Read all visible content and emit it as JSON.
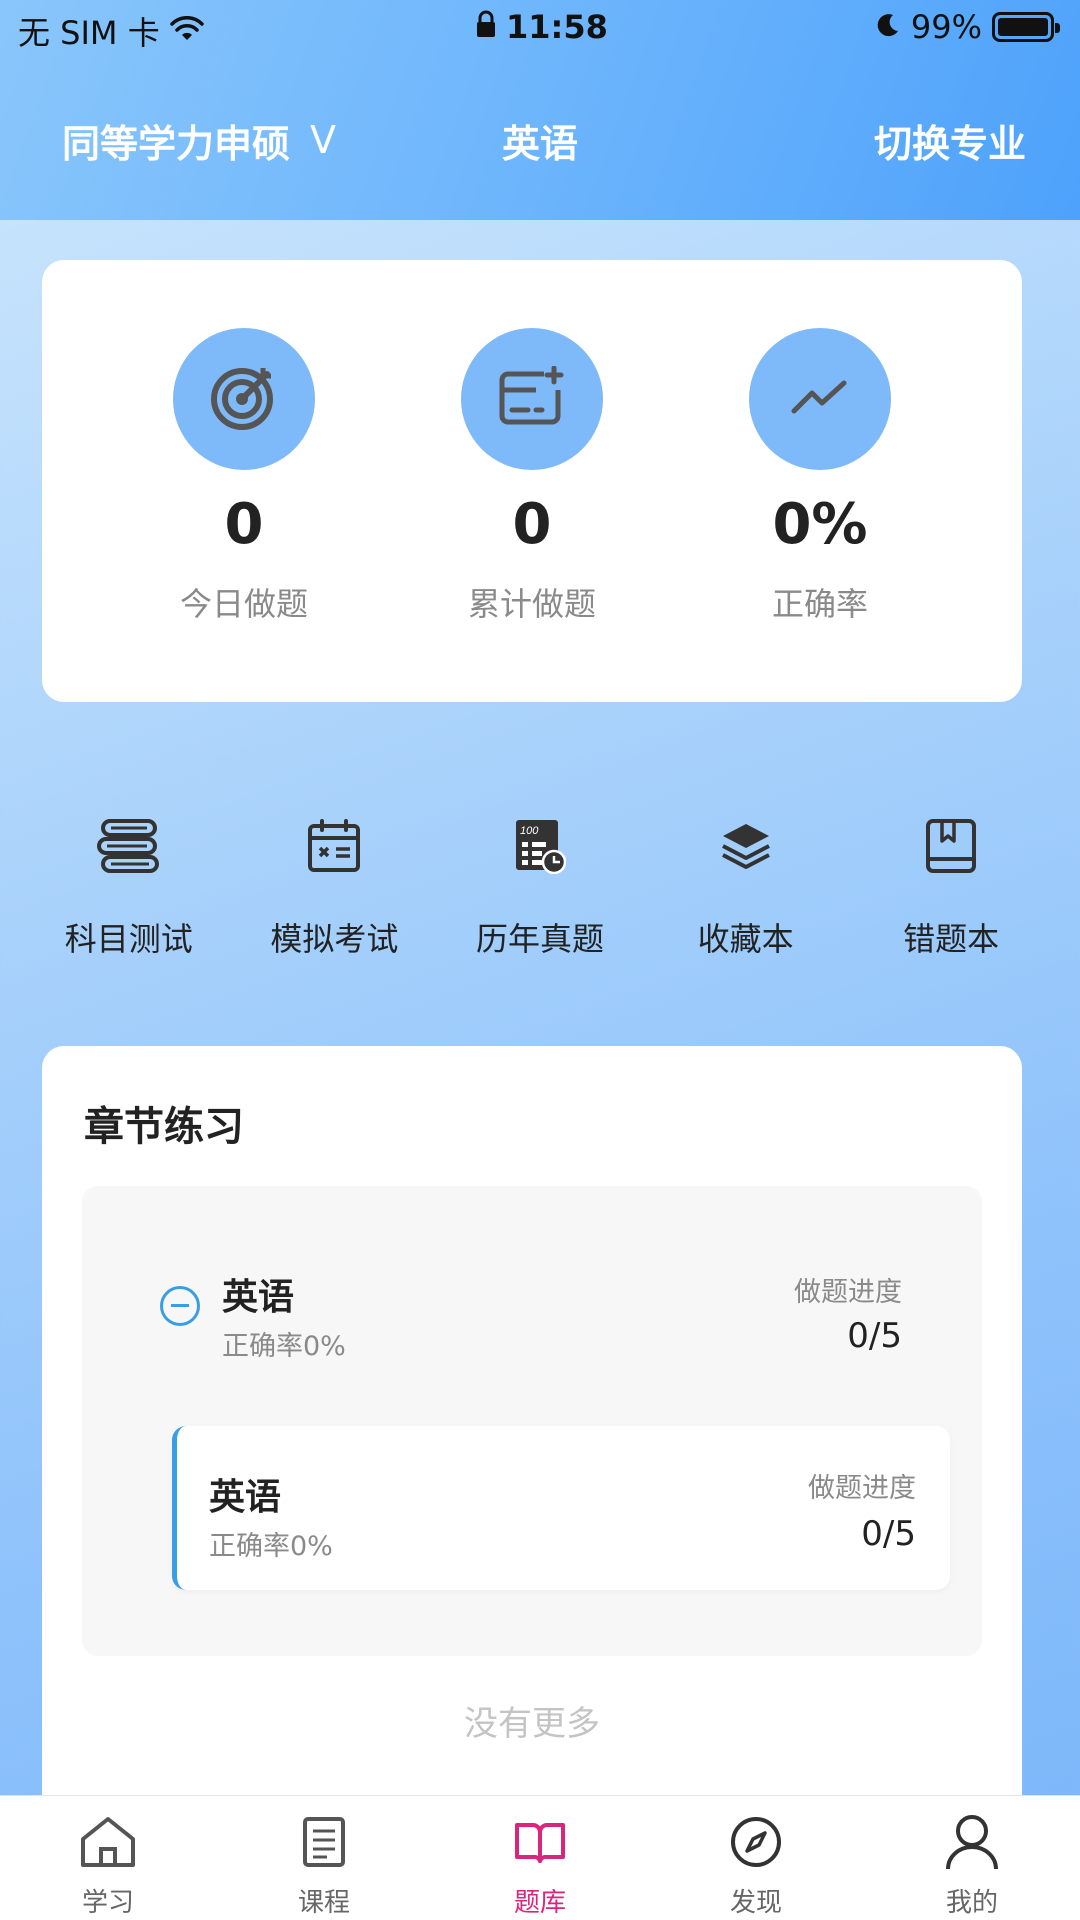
{
  "status_bar": {
    "carrier": "无 SIM 卡",
    "time": "11:58",
    "battery": "99%",
    "battery_level": 0.99
  },
  "header": {
    "left_title": "同等学力申硕",
    "left_chevron": "V",
    "center_title": "英语",
    "right_action": "切换专业"
  },
  "stats": [
    {
      "value": "0",
      "label": "今日做题",
      "icon": "target-icon"
    },
    {
      "value": "0",
      "label": "累计做题",
      "icon": "card-add-icon"
    },
    {
      "value": "0%",
      "label": "正确率",
      "icon": "trend-icon"
    }
  ],
  "actions": [
    {
      "label": "科目测试",
      "icon": "books-icon"
    },
    {
      "label": "模拟考试",
      "icon": "calendar-exam-icon"
    },
    {
      "label": "历年真题",
      "icon": "past-papers-icon"
    },
    {
      "label": "收藏本",
      "icon": "layers-icon"
    },
    {
      "label": "错题本",
      "icon": "book-bookmark-icon"
    }
  ],
  "chapter": {
    "title": "章节练习",
    "group": {
      "name": "英语",
      "accuracy": "正确率0%",
      "progress_label": "做题进度",
      "progress": "0/5"
    },
    "items": [
      {
        "name": "英语",
        "accuracy": "正确率0%",
        "progress_label": "做题进度",
        "progress": "0/5"
      }
    ],
    "no_more": "没有更多"
  },
  "tabbar": [
    {
      "label": "学习",
      "icon": "home-icon"
    },
    {
      "label": "课程",
      "icon": "document-icon"
    },
    {
      "label": "题库",
      "icon": "open-book-icon",
      "active": true
    },
    {
      "label": "发现",
      "icon": "compass-icon"
    },
    {
      "label": "我的",
      "icon": "user-icon"
    }
  ],
  "colors": {
    "accent": "#3a9ee4",
    "active_tab": "#d9267c",
    "stat_circle": "#7eb9f9",
    "header_start": "#89c6fb",
    "header_end": "#4ea2fb"
  }
}
